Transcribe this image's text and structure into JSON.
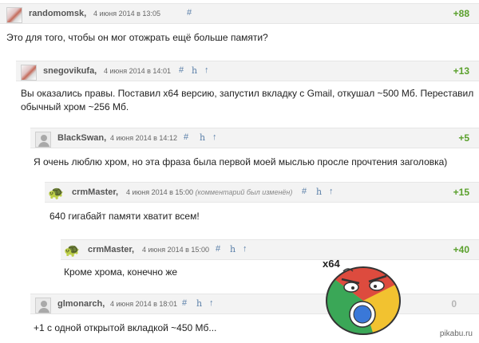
{
  "comments": [
    {
      "author": "randomomsk,",
      "date": "4 июня 2014 в 13:05",
      "anchor": "#",
      "rating": "+88",
      "text": "Это для того, чтобы он мог отожрать ещё больше памяти?"
    },
    {
      "author": "snegovikufa,",
      "date": "4 июня 2014 в 14:01",
      "anchor": "#",
      "h": "h",
      "up": "↑",
      "rating": "+13",
      "text": "Вы оказались правы. Поставил x64 версию, запустил вкладку с Gmail, откушал ~500 Мб. Переставил обычный хром ~256 Мб."
    },
    {
      "author": "BlackSwan,",
      "date": "4 июня 2014 в 14:12",
      "anchor": "#",
      "h": "h",
      "up": "↑",
      "rating": "+5",
      "text": "Я очень люблю хром, но эта фраза была первой моей мыслью просле прочтения заголовка)"
    },
    {
      "author": "crmMaster,",
      "date": "4 июня 2014 в 15:00",
      "edited": "(комментарий был изменён)",
      "anchor": "#",
      "h": "h",
      "up": "↑",
      "rating": "+15",
      "text": "640 гигабайт памяти хватит всем!"
    },
    {
      "author": "crmMaster,",
      "date": "4 июня 2014 в 15:00",
      "anchor": "#",
      "h": "h",
      "up": "↑",
      "rating": "+40",
      "text": "Кроме хрома, конечно же"
    },
    {
      "author": "glmonarch,",
      "date": "4 июня 2014 в 18:01",
      "anchor": "#",
      "h": "h",
      "up": "↑",
      "rating": "0",
      "text": "+1 с одной открытой вкладкой ~450 Мб..."
    }
  ],
  "meme": {
    "label": "x64"
  },
  "watermark": "pikabu.ru",
  "colors": {
    "positive": "#5aa02c",
    "zero": "#b5b5b5",
    "link": "#5a7fa8",
    "header_bg": "#f3f3f3"
  }
}
